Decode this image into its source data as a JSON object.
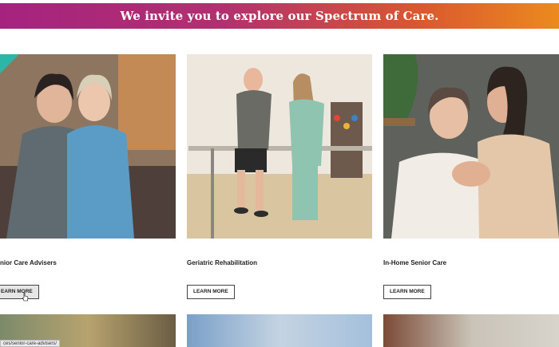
{
  "banner": {
    "title": "We invite you to explore our Spectrum of Care."
  },
  "cards": [
    {
      "title": "Senior Care Advisers",
      "visible_title": "nior Care Advisers",
      "button": "LEARN MORE",
      "visible_button": "EARN MORE"
    },
    {
      "title": "Geriatric Rehabilitation",
      "button": "LEARN MORE"
    },
    {
      "title": "In-Home Senior Care",
      "button": "LEARN MORE"
    }
  ],
  "status_bar": {
    "url": "ces/senior-care-advisers/"
  }
}
